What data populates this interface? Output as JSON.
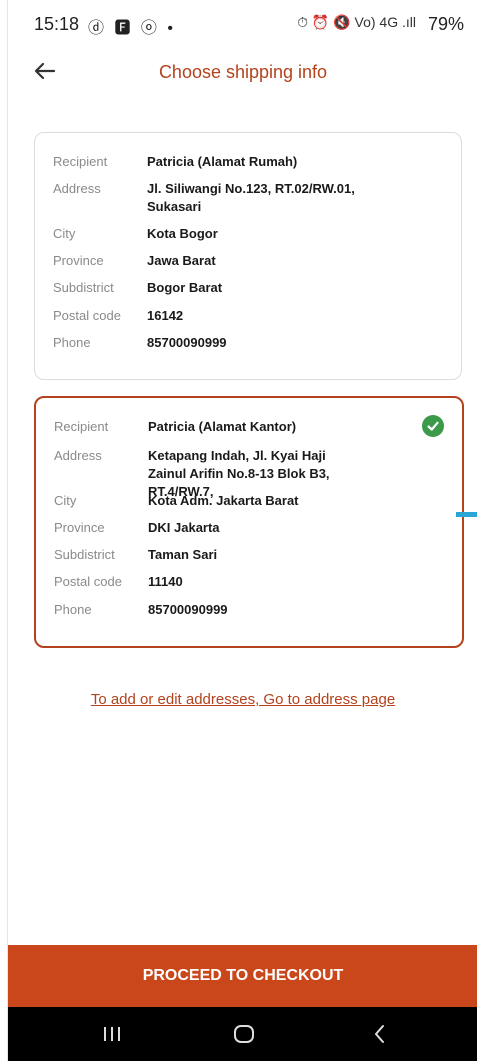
{
  "status_bar": {
    "time": "15:18",
    "left_icons": "ⓓ 🅵 ⓞ •",
    "right_icons": "⏱ ⏰ 🔇 Vo) 4G .ıll",
    "battery": "79%"
  },
  "header": {
    "title": "Choose shipping info",
    "back_icon": "arrow-left-icon"
  },
  "addresses": [
    {
      "selected": false,
      "fields": [
        {
          "label": "Recipient",
          "value": "Patricia (Alamat Rumah)"
        },
        {
          "label": "Address",
          "value": "Jl. Siliwangi No.123, RT.02/RW.01, Sukasari"
        },
        {
          "label": "City",
          "value": "Kota Bogor"
        },
        {
          "label": "Province",
          "value": "Jawa Barat"
        },
        {
          "label": "Subdistrict",
          "value": "Bogor Barat"
        },
        {
          "label": "Postal code",
          "value": "16142"
        },
        {
          "label": "Phone",
          "value": "85700090999"
        }
      ]
    },
    {
      "selected": true,
      "fields": [
        {
          "label": "Recipient",
          "value": "Patricia (Alamat Kantor)"
        },
        {
          "label": "Address",
          "value": "Ketapang Indah, Jl. Kyai Haji Zainul Arifin No.8-13 Blok B3, RT.4/RW.7,"
        },
        {
          "label": "City",
          "value": "Kota Adm. Jakarta Barat"
        },
        {
          "label": "Province",
          "value": "DKI Jakarta"
        },
        {
          "label": "Subdistrict",
          "value": "Taman Sari"
        },
        {
          "label": "Postal code",
          "value": "11140"
        },
        {
          "label": "Phone",
          "value": "85700090999"
        }
      ]
    }
  ],
  "address_page_link": "To add or edit addresses, Go to address page",
  "checkout_button": "PROCEED TO CHECKOUT",
  "colors": {
    "accent": "#b3421d",
    "cta": "#c9471a",
    "selected_check": "#3a9a4a"
  },
  "nav": {
    "recent_icon": "recent-apps-icon",
    "home_icon": "home-icon",
    "back_icon": "back-icon"
  }
}
